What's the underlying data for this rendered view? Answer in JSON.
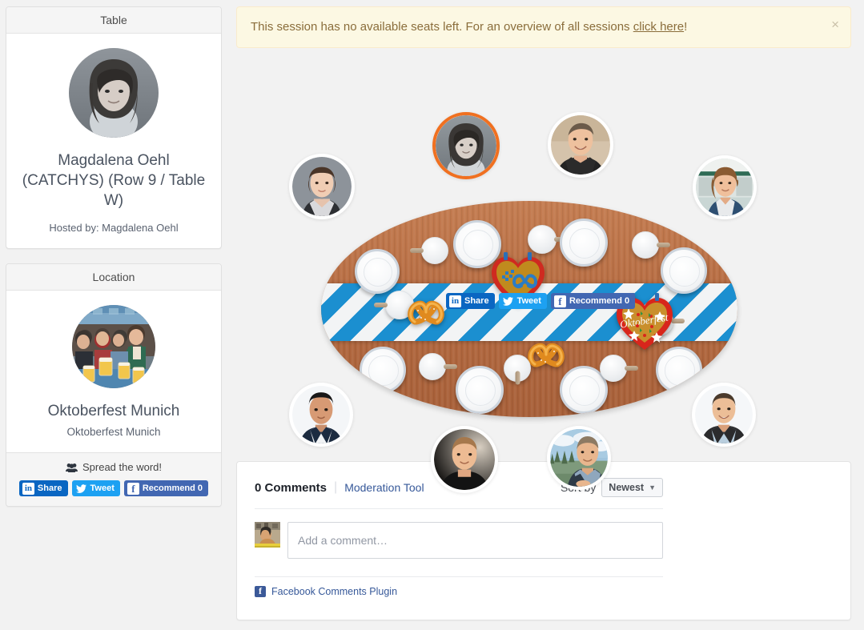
{
  "alert": {
    "text_before": "This session has no available seats left. For an overview of all sessions ",
    "link_text": "click here",
    "text_after": "!",
    "close_label": "×"
  },
  "table_panel": {
    "header": "Table",
    "title": "Magdalena Oehl (CATCHYS) (Row 9 / Table W)",
    "hosted_by": "Hosted by: Magdalena Oehl"
  },
  "location_panel": {
    "header": "Location",
    "name": "Oktoberfest Munich",
    "subtitle": "Oktoberfest Munich",
    "spread_label": "Spread the word!"
  },
  "share": {
    "linkedin_label": "Share",
    "linkedin_icon": "linkedin-icon",
    "twitter_label": "Tweet",
    "twitter_icon": "twitter-bird-icon",
    "facebook_label": "Recommend 0",
    "facebook_icon": "facebook-icon"
  },
  "table_scene": {
    "heart_left_text": "",
    "heart_right_text": "Oktoberfest",
    "seats": [
      {
        "id": "seat-left-top",
        "name": "seat-occupant-1",
        "host": false
      },
      {
        "id": "seat-host",
        "name": "seat-occupant-host",
        "host": true
      },
      {
        "id": "seat-top-right",
        "name": "seat-occupant-2",
        "host": false
      },
      {
        "id": "seat-right-top",
        "name": "seat-occupant-3",
        "host": false
      },
      {
        "id": "seat-left-bottom",
        "name": "seat-occupant-4",
        "host": false
      },
      {
        "id": "seat-bottom-left",
        "name": "seat-occupant-5",
        "host": false
      },
      {
        "id": "seat-bottom-right",
        "name": "seat-occupant-6",
        "host": false
      },
      {
        "id": "seat-right-bottom",
        "name": "seat-occupant-7",
        "host": false
      }
    ]
  },
  "comments": {
    "count_label": "0 Comments",
    "moderation_label": "Moderation Tool",
    "sort_label": "Sort by",
    "sort_value": "Newest",
    "input_placeholder": "Add a comment…",
    "plugin_label": "Facebook Comments Plugin"
  },
  "colors": {
    "page_bg": "#f2f2f2",
    "alert_bg": "#fcf8e3",
    "alert_border": "#faebcc",
    "alert_text": "#8a6d3b",
    "host_ring": "#f07020",
    "table_wood": "#b4693f",
    "runner_blue": "#1b8fd0",
    "linkedin": "#0a66c2",
    "twitter": "#1da1f2",
    "facebook": "#4267b2"
  }
}
